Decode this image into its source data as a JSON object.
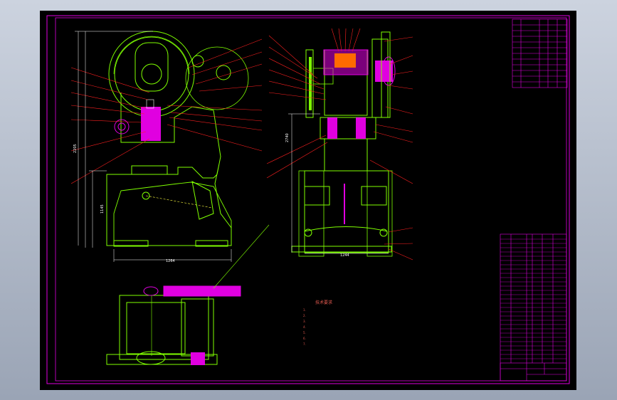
{
  "drawing": {
    "background_color": "#000000",
    "frame_color": "#e000e0",
    "outline_color": "#7fff00",
    "leader_color": "#ff2020",
    "dimension_color": "#ffffff",
    "hatch_color": "#e000e0",
    "notes_color": "#e25a4f",
    "overall_width_front": "1264",
    "overall_width_side": "1244",
    "height_total": "2205",
    "height_side": "2740",
    "height_lower": "1145",
    "technical_notes_title": "技术要求",
    "technical_notes": [
      "1.",
      "2.",
      "3.",
      "4.",
      "5.",
      "6.",
      "7."
    ]
  }
}
